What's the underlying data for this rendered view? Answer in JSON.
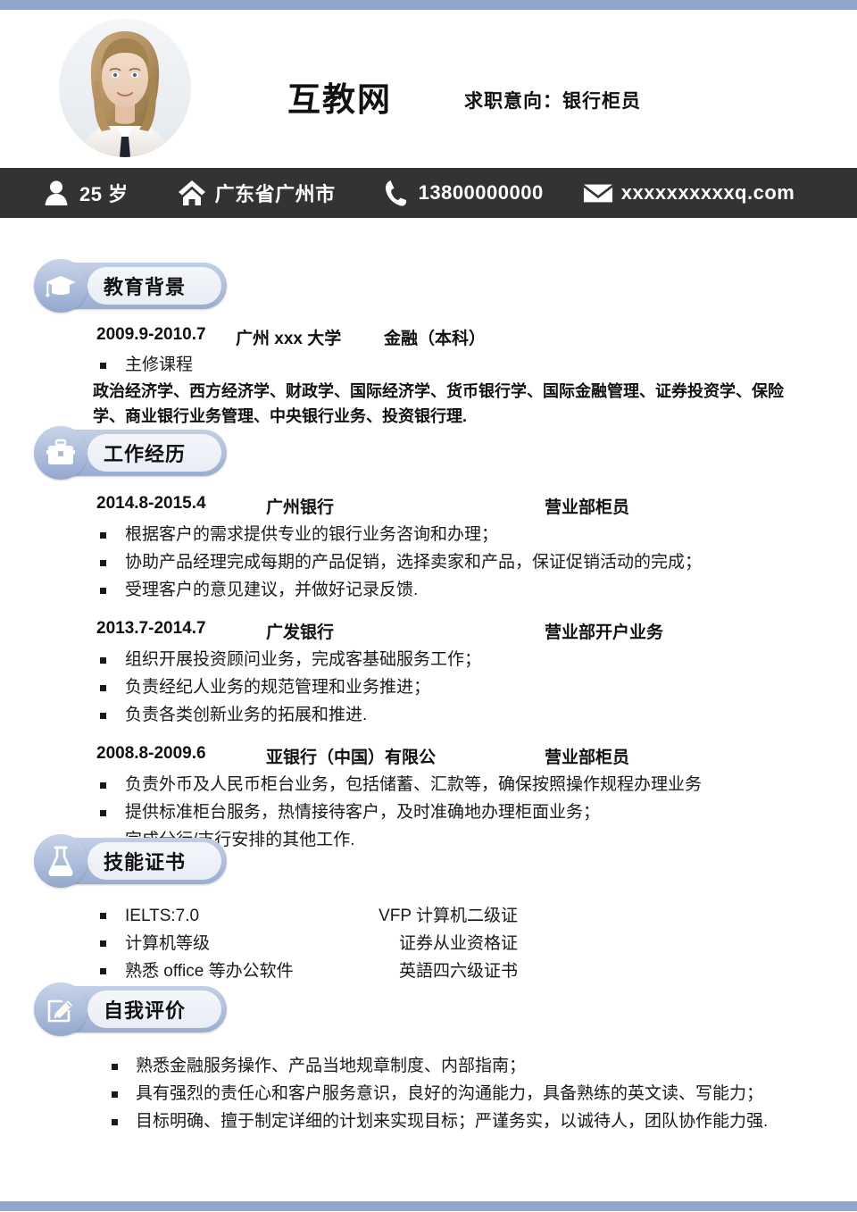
{
  "theme": {
    "accent_bar": "#8fa6cd",
    "contact_bar_bg": "#333333",
    "badge_blue": "#aebedc",
    "text": "#1a1a1a"
  },
  "header": {
    "photo_alt": "portrait-photo",
    "title": "互教网",
    "objective": "求职意向：银行柜员"
  },
  "contact": {
    "items": [
      {
        "icon": "person-icon",
        "text": "25 岁"
      },
      {
        "icon": "home-icon",
        "text": "广东省广州市"
      },
      {
        "icon": "phone-icon",
        "text": "13800000000"
      },
      {
        "icon": "mail-icon",
        "text": "xxxxxxxxxxq.com"
      }
    ]
  },
  "sections": {
    "education": {
      "badge_icon": "graduation-cap-icon",
      "title": "教育背景",
      "entry": {
        "date": "2009.9-2010.7",
        "org": "广州 xxx 大学",
        "role": "金融（本科）"
      },
      "course_label": "主修课程",
      "course_body": "政治经济学、西方经济学、财政学、国际经济学、货币银行学、国际金融管理、证券投资学、保险学、商业银行业务管理、中央银行业务、投资银行理."
    },
    "work": {
      "badge_icon": "briefcase-icon",
      "title": "工作经历",
      "entries": [
        {
          "date": "2014.8-2015.4",
          "org": "广州银行",
          "role": "营业部柜员",
          "bullets": [
            "根据客户的需求提供专业的银行业务咨询和办理；",
            "协助产品经理完成每期的产品促销，选择卖家和产品，保证促销活动的完成；",
            "受理客户的意见建议，并做好记录反馈."
          ]
        },
        {
          "date": "2013.7-2014.7",
          "org": "广发银行",
          "role": "营业部开户业务",
          "bullets": [
            "组织开展投资顾问业务，完成客基础服务工作；",
            "负责经纪人业务的规范管理和业务推进；",
            "负责各类创新业务的拓展和推进."
          ]
        },
        {
          "date": "2008.8-2009.6",
          "org": "亚银行（中国）有限公",
          "role": "营业部柜员",
          "bullets": [
            "负责外币及人民币柜台业务，包括储蓄、汇款等，确保按照操作规程办理业务",
            "提供标准柜台服务，热情接待客户，及时准确地办理柜面业务；",
            "完成分行/支行安排的其他工作."
          ]
        }
      ]
    },
    "skills": {
      "badge_icon": "flask-icon",
      "title": "技能证书",
      "rows": [
        {
          "left": "IELTS:7.0",
          "right": "VFP 计算机二级证"
        },
        {
          "left": "计算机等级",
          "right": "证券从业资格证"
        },
        {
          "left": "熟悉 office 等办公软件",
          "right": "英語四六级证书"
        }
      ]
    },
    "self_evaluation": {
      "badge_icon": "pencil-edit-icon",
      "title": "自我评价",
      "bullets": [
        "熟悉金融服务操作、产品当地规章制度、内部指南；",
        "具有强烈的责任心和客户服务意识，良好的沟通能力，具备熟练的英文读、写能力；",
        "目标明确、擅于制定详细的计划来实现目标；严谨务实，以诚待人，团队协作能力强."
      ]
    }
  }
}
